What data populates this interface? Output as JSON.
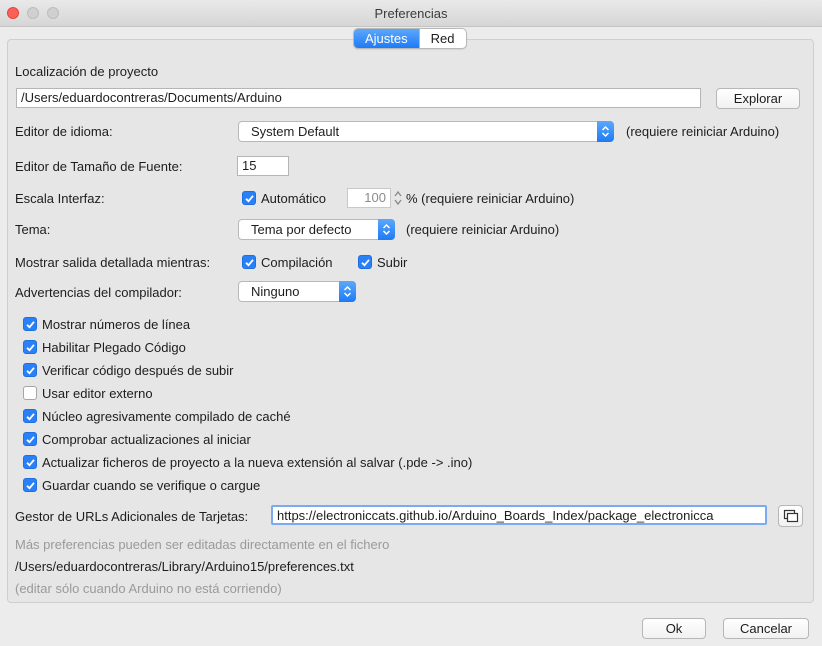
{
  "window": {
    "title": "Preferencias"
  },
  "tabs": [
    {
      "label": "Ajustes",
      "active": true
    },
    {
      "label": "Red",
      "active": false
    }
  ],
  "sketchbook": {
    "label": "Localización de proyecto",
    "path": "/Users/eduardocontreras/Documents/Arduino",
    "browse_label": "Explorar"
  },
  "language": {
    "label": "Editor de idioma:",
    "value": "System Default",
    "note": "(requiere reiniciar Arduino)"
  },
  "font_size": {
    "label": "Editor de Tamaño de Fuente:",
    "value": "15"
  },
  "scale": {
    "label": "Escala Interfaz:",
    "auto_label": "Automático",
    "auto_checked": true,
    "value": "100",
    "note": "% (requiere reiniciar Arduino)"
  },
  "theme": {
    "label": "Tema:",
    "value": "Tema por defecto",
    "note": "(requiere reiniciar Arduino)"
  },
  "verbose": {
    "label": "Mostrar salida detallada mientras:",
    "compile_label": "Compilación",
    "compile_checked": true,
    "upload_label": "Subir",
    "upload_checked": true
  },
  "warnings": {
    "label": "Advertencias del compilador:",
    "value": "Ninguno"
  },
  "options": [
    {
      "label": "Mostrar números de línea",
      "checked": true
    },
    {
      "label": "Habilitar Plegado Código",
      "checked": true
    },
    {
      "label": "Verificar código después de subir",
      "checked": true
    },
    {
      "label": "Usar editor externo",
      "checked": false
    },
    {
      "label": "Núcleo agresivamente compilado de caché",
      "checked": true
    },
    {
      "label": "Comprobar actualizaciones al iniciar",
      "checked": true
    },
    {
      "label": "Actualizar ficheros de proyecto a la nueva extensión al salvar (.pde -> .ino)",
      "checked": true
    },
    {
      "label": "Guardar cuando se verifique o cargue",
      "checked": true
    }
  ],
  "board_urls": {
    "label": "Gestor de URLs Adicionales de Tarjetas:",
    "value": "https://electroniccats.github.io/Arduino_Boards_Index/package_electronicca"
  },
  "prefs_info": {
    "more_text": "Más preferencias pueden ser editadas directamente en el fichero",
    "file_path": "/Users/eduardocontreras/Library/Arduino15/preferences.txt",
    "edit_note": "(editar sólo cuando Arduino no está corriendo)"
  },
  "footer": {
    "ok_label": "Ok",
    "cancel_label": "Cancelar"
  },
  "colors": {
    "accent": "#2a80f7",
    "close": "#fc5f57",
    "background": "#ececec"
  }
}
